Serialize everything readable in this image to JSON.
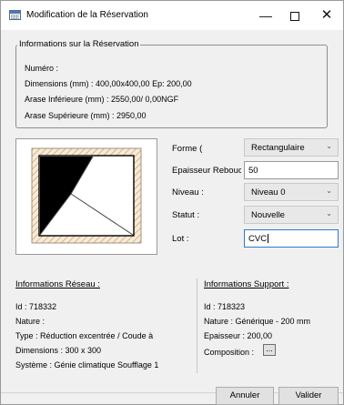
{
  "window": {
    "title": "Modification de la Réservation",
    "controls": {
      "minimize": "—",
      "maximize": "",
      "close": "✕"
    }
  },
  "info_group": {
    "title": "Informations sur la Réservation",
    "numero": "Numéro :",
    "dimensions": "Dimensions  (mm) : 400,00x400,00 Ep: 200,00",
    "arase_inf": "Arase Inférieure  (mm) : 2550,00/ 0,00NGF",
    "arase_sup": "Arase Supérieure  (mm) : 2950,00"
  },
  "form": {
    "forme_label": "Forme (",
    "forme_value": "Rectangulaire",
    "epaisseur_label": "Epaisseur Rebouc",
    "epaisseur_value": "50",
    "niveau_label": "Niveau :",
    "niveau_value": "Niveau 0",
    "statut_label": "Statut :",
    "statut_value": "Nouvelle",
    "lot_label": "Lot :",
    "lot_value": "CVC"
  },
  "network": {
    "title": "Informations Réseau :",
    "id": "Id : 718332",
    "nature": "Nature :",
    "type": "Type : Réduction excentrée / Coude à",
    "dimensions": "Dimensions : 300 x 300",
    "systeme": "Système : Génie climatique Soufflage 1"
  },
  "support": {
    "title": "Informations Support :",
    "id": "Id : 718323",
    "nature": "Nature : Générique - 200 mm",
    "epaisseur": "Epaisseur : 200,00",
    "composition": "Composition :",
    "composition_btn": "..."
  },
  "buttons": {
    "annuler": "Annuler",
    "valider": "Valider"
  },
  "icons": {
    "dropdown": "chevron-down-icon",
    "app": "table-icon"
  }
}
